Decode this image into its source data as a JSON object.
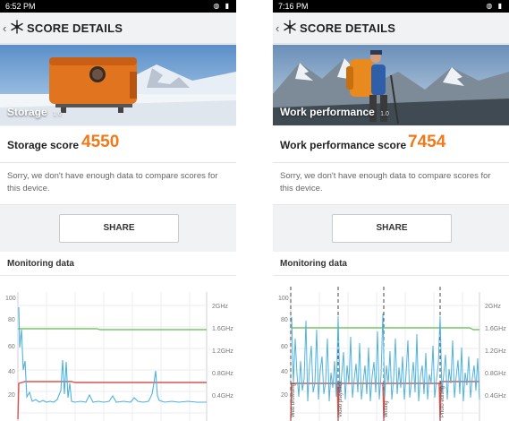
{
  "colors": {
    "score": "#f07a1a",
    "line_blue": "#4fb3e0",
    "line_green": "#7cc66a",
    "line_red": "#d9534f"
  },
  "left": {
    "status": {
      "time": "6:52 PM",
      "icons": "wifi-icon battery-icon"
    },
    "appbar": {
      "title": "SCORE DETAILS"
    },
    "hero": {
      "label": "Storage",
      "version": "1.0"
    },
    "score": {
      "label": "Storage score",
      "value": "4550"
    },
    "message": "Sorry, we don't have enough data to compare scores for this device.",
    "share": "SHARE",
    "monitoring": {
      "title": "Monitoring data",
      "y_left_ticks": [
        "100",
        "80",
        "60",
        "40",
        "20"
      ],
      "y_right_ticks": [
        "2GHz",
        "1.6GHz",
        "1.2GHz",
        "0.8GHz",
        "0.4GHz"
      ]
    }
  },
  "right": {
    "status": {
      "time": "7:16 PM",
      "icons": "wifi-icon battery-icon"
    },
    "appbar": {
      "title": "SCORE DETAILS"
    },
    "hero": {
      "label": "Work performance",
      "version": "1.0"
    },
    "score": {
      "label": "Work performance score",
      "value": "7454"
    },
    "message": "Sorry, we don't have enough data to compare scores for this device.",
    "share": "SHARE",
    "monitoring": {
      "title": "Monitoring data",
      "y_left_ticks": [
        "100",
        "80",
        "60",
        "40",
        "20"
      ],
      "y_right_ticks": [
        "2GHz",
        "1.6GHz",
        "1.2GHz",
        "0.8GHz",
        "0.4GHz"
      ],
      "section_labels": [
        "Web browsing",
        "Video playback",
        "Writing",
        "Photo editing"
      ]
    }
  }
}
